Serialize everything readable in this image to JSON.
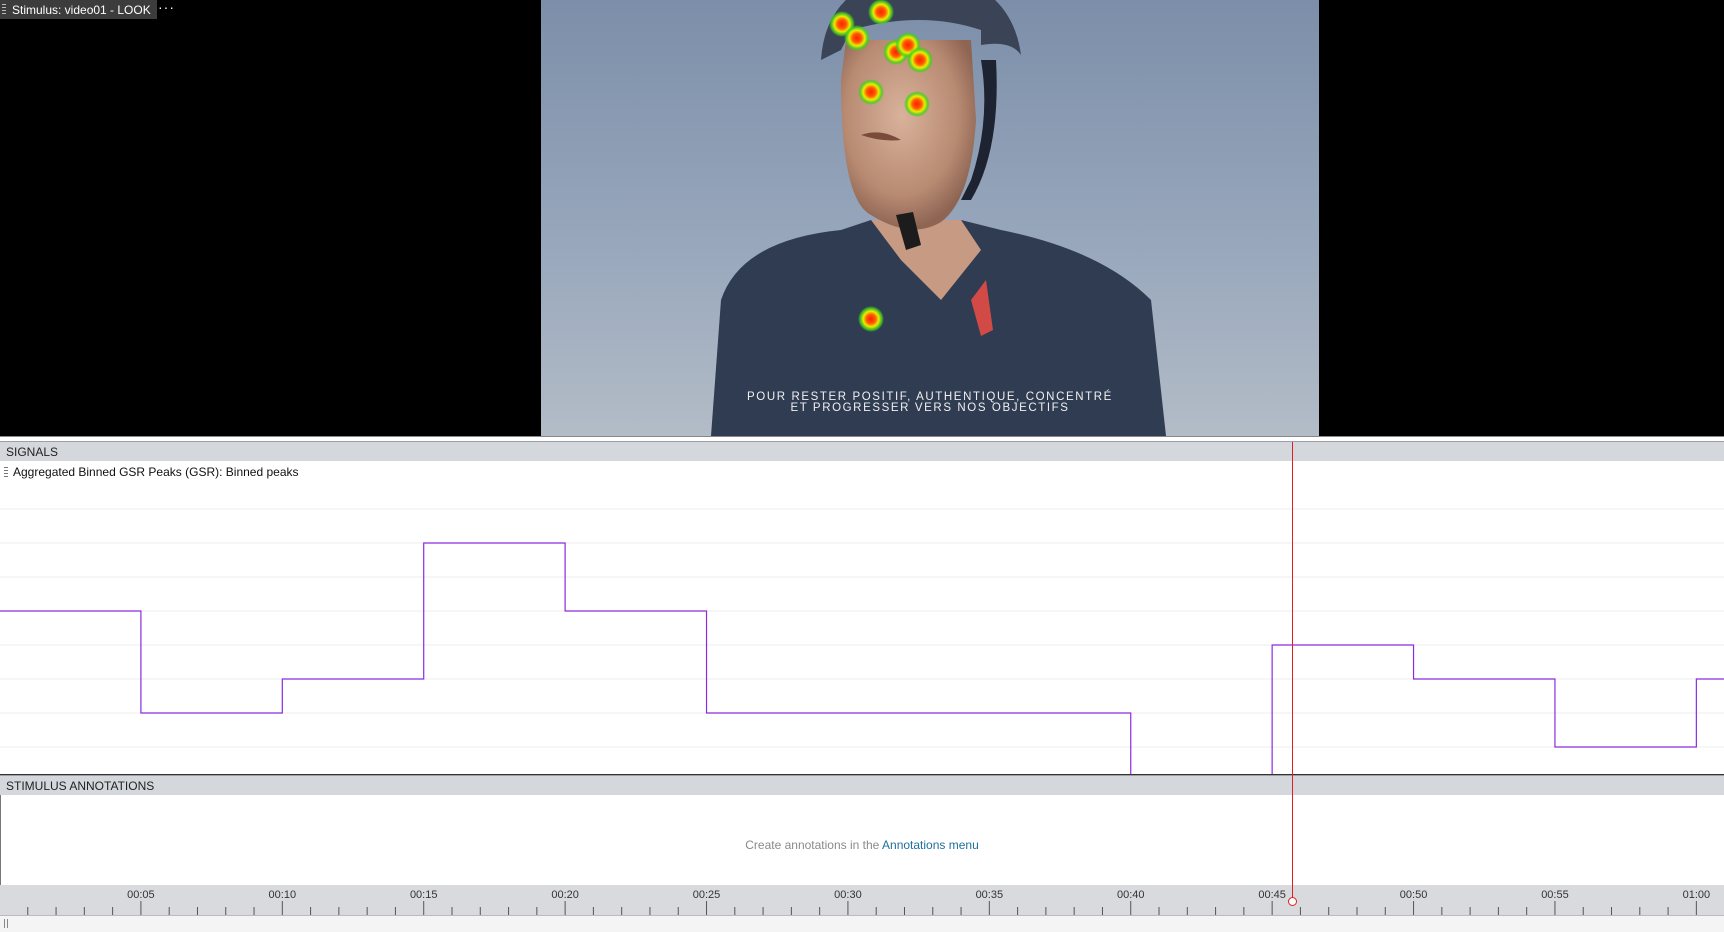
{
  "stimulus_tab": {
    "title": "Stimulus: video01 - LOOK",
    "menu": "···"
  },
  "video": {
    "subtitle_line1": "POUR RESTER POSITIF, AUTHENTIQUE, CONCENTRÉ",
    "subtitle_line2": "ET PROGRESSER VERS NOS OBJECTIFS"
  },
  "signals": {
    "header": "SIGNALS",
    "signal_label": "Aggregated Binned GSR Peaks (GSR): Binned peaks"
  },
  "chart_data": {
    "type": "line",
    "step": true,
    "color": "#8a2be2",
    "x_unit": "seconds",
    "xlim": [
      0,
      60.5
    ],
    "ylim": [
      0,
      8
    ],
    "grid": true,
    "x": [
      0,
      5,
      10,
      15,
      20,
      25,
      30,
      35,
      40,
      45,
      50,
      55,
      60
    ],
    "y": [
      5,
      2,
      3,
      7,
      5,
      2,
      2,
      2,
      0,
      4,
      3,
      1,
      3
    ]
  },
  "annotations": {
    "header": "STIMULUS ANNOTATIONS",
    "message_prefix": "Create annotations in the ",
    "message_link": "Annotations menu"
  },
  "timeline": {
    "ticks": [
      "00:05",
      "00:10",
      "00:15",
      "00:20",
      "00:25",
      "00:30",
      "00:35",
      "00:40",
      "00:45",
      "00:50",
      "00:55",
      "01:00"
    ],
    "playhead_seconds": 45.7
  },
  "colors": {
    "playhead": "#e02020",
    "signal_line": "#8a2be2",
    "link": "#1f6f9c"
  }
}
